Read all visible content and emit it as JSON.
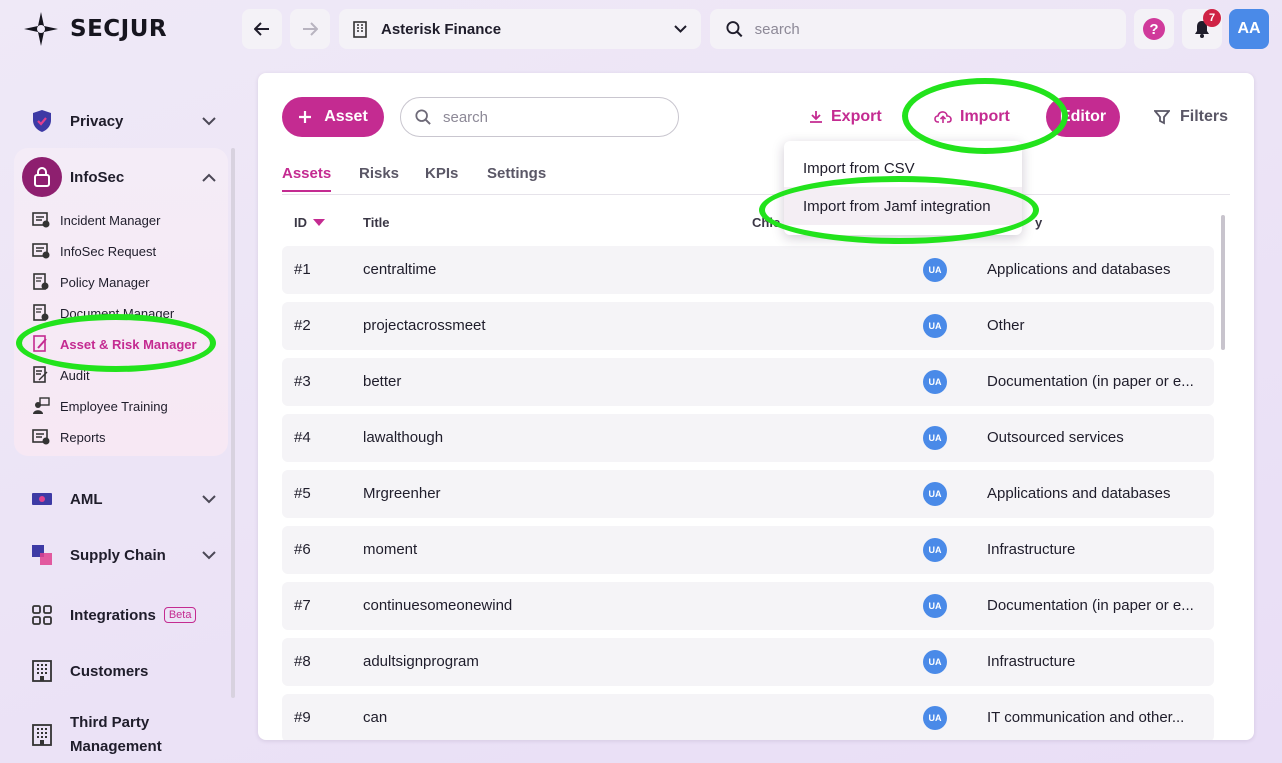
{
  "brand": {
    "name": "SECJUR"
  },
  "sidebar": {
    "sections": [
      {
        "label": "Privacy",
        "icon": "shield-icon"
      },
      {
        "label": "InfoSec",
        "icon": "lock-icon"
      },
      {
        "label": "AML",
        "icon": "flag-icon"
      },
      {
        "label": "Supply Chain",
        "icon": "supply-chain-icon"
      },
      {
        "label": "Integrations",
        "icon": "grid-icon",
        "badge": "Beta"
      },
      {
        "label": "Customers",
        "icon": "building-icon"
      },
      {
        "label": "Third Party Management",
        "icon": "building-icon"
      }
    ],
    "infosec_items": [
      {
        "label": "Incident Manager"
      },
      {
        "label": "InfoSec Request"
      },
      {
        "label": "Policy Manager"
      },
      {
        "label": "Document Manager"
      },
      {
        "label": "Asset & Risk Manager",
        "active": true
      },
      {
        "label": "Audit"
      },
      {
        "label": "Employee Training"
      },
      {
        "label": "Reports"
      }
    ]
  },
  "topbar": {
    "organization": "Asterisk Finance",
    "search_placeholder": "search",
    "notifications_count": "7",
    "avatar_initials": "AA"
  },
  "toolbar": {
    "add_label": "Asset",
    "search_placeholder": "search",
    "export_label": "Export",
    "import_label": "Import",
    "editor_label": "Editor",
    "filters_label": "Filters"
  },
  "import_menu": {
    "items": [
      "Import from CSV",
      "Import from Jamf integration"
    ]
  },
  "tabs": [
    "Assets",
    "Risks",
    "KPIs",
    "Settings"
  ],
  "table": {
    "headers": {
      "id": "ID",
      "title": "Title",
      "owner": "Chie",
      "category": "y"
    },
    "rows": [
      {
        "id": "#1",
        "title": "centraltime",
        "owner": "UA",
        "category": "Applications and databases"
      },
      {
        "id": "#2",
        "title": "projectacrossmeet",
        "owner": "UA",
        "category": "Other"
      },
      {
        "id": "#3",
        "title": "better",
        "owner": "UA",
        "category": "Documentation (in paper or e..."
      },
      {
        "id": "#4",
        "title": "lawalthough",
        "owner": "UA",
        "category": "Outsourced services"
      },
      {
        "id": "#5",
        "title": "Mrgreenher",
        "owner": "UA",
        "category": "Applications and databases"
      },
      {
        "id": "#6",
        "title": "moment",
        "owner": "UA",
        "category": "Infrastructure"
      },
      {
        "id": "#7",
        "title": "continuesomeonewind",
        "owner": "UA",
        "category": "Documentation (in paper or e..."
      },
      {
        "id": "#8",
        "title": "adultsignprogram",
        "owner": "UA",
        "category": "Infrastructure"
      },
      {
        "id": "#9",
        "title": "can",
        "owner": "UA",
        "category": "IT communication and other..."
      }
    ]
  },
  "colors": {
    "accent": "#c42b91",
    "annotation": "#22e31c",
    "avatar": "#4a8ae8"
  }
}
